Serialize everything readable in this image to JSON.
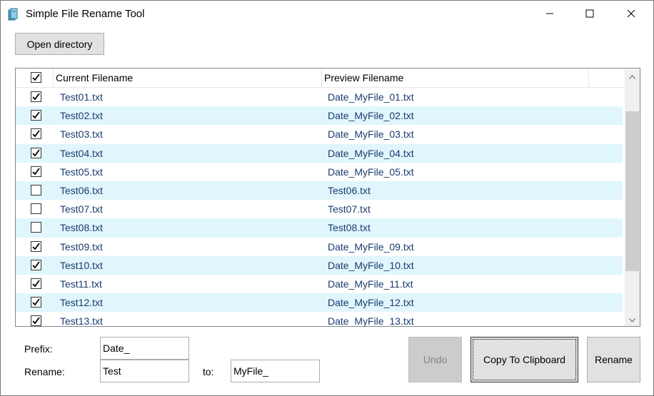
{
  "window": {
    "title": "Simple File Rename Tool",
    "controls": [
      "minimize-icon",
      "maximize-icon",
      "close-icon"
    ]
  },
  "toolbar": {
    "open_label": "Open directory"
  },
  "list": {
    "header_checked": true,
    "columns": [
      "Current Filename",
      "Preview Filename"
    ],
    "rows": [
      {
        "checked": true,
        "current": "Test01.txt",
        "preview": "Date_MyFile_01.txt"
      },
      {
        "checked": true,
        "current": "Test02.txt",
        "preview": "Date_MyFile_02.txt"
      },
      {
        "checked": true,
        "current": "Test03.txt",
        "preview": "Date_MyFile_03.txt"
      },
      {
        "checked": true,
        "current": "Test04.txt",
        "preview": "Date_MyFile_04.txt"
      },
      {
        "checked": true,
        "current": "Test05.txt",
        "preview": "Date_MyFile_05.txt"
      },
      {
        "checked": false,
        "current": "Test06.txt",
        "preview": "Test06.txt"
      },
      {
        "checked": false,
        "current": "Test07.txt",
        "preview": "Test07.txt"
      },
      {
        "checked": false,
        "current": "Test08.txt",
        "preview": "Test08.txt"
      },
      {
        "checked": true,
        "current": "Test09.txt",
        "preview": "Date_MyFile_09.txt"
      },
      {
        "checked": true,
        "current": "Test10.txt",
        "preview": "Date_MyFile_10.txt"
      },
      {
        "checked": true,
        "current": "Test11.txt",
        "preview": "Date_MyFile_11.txt"
      },
      {
        "checked": true,
        "current": "Test12.txt",
        "preview": "Date_MyFile_12.txt"
      },
      {
        "checked": true,
        "current": "Test13.txt",
        "preview": "Date_MyFile_13.txt"
      }
    ]
  },
  "form": {
    "prefix_label": "Prefix:",
    "prefix_value": "Date_",
    "rename_label": "Rename:",
    "rename_value": "Test",
    "to_label": "to:",
    "to_value": "MyFile_"
  },
  "actions": {
    "undo_label": "Undo",
    "copy_label": "Copy To Clipboard",
    "rename_label": "Rename"
  },
  "colors": {
    "row_alt": "#e0f6fc",
    "filename_text": "#1a3b6f",
    "button_bg": "#e1e1e1",
    "disabled_bg": "#cccccc"
  }
}
